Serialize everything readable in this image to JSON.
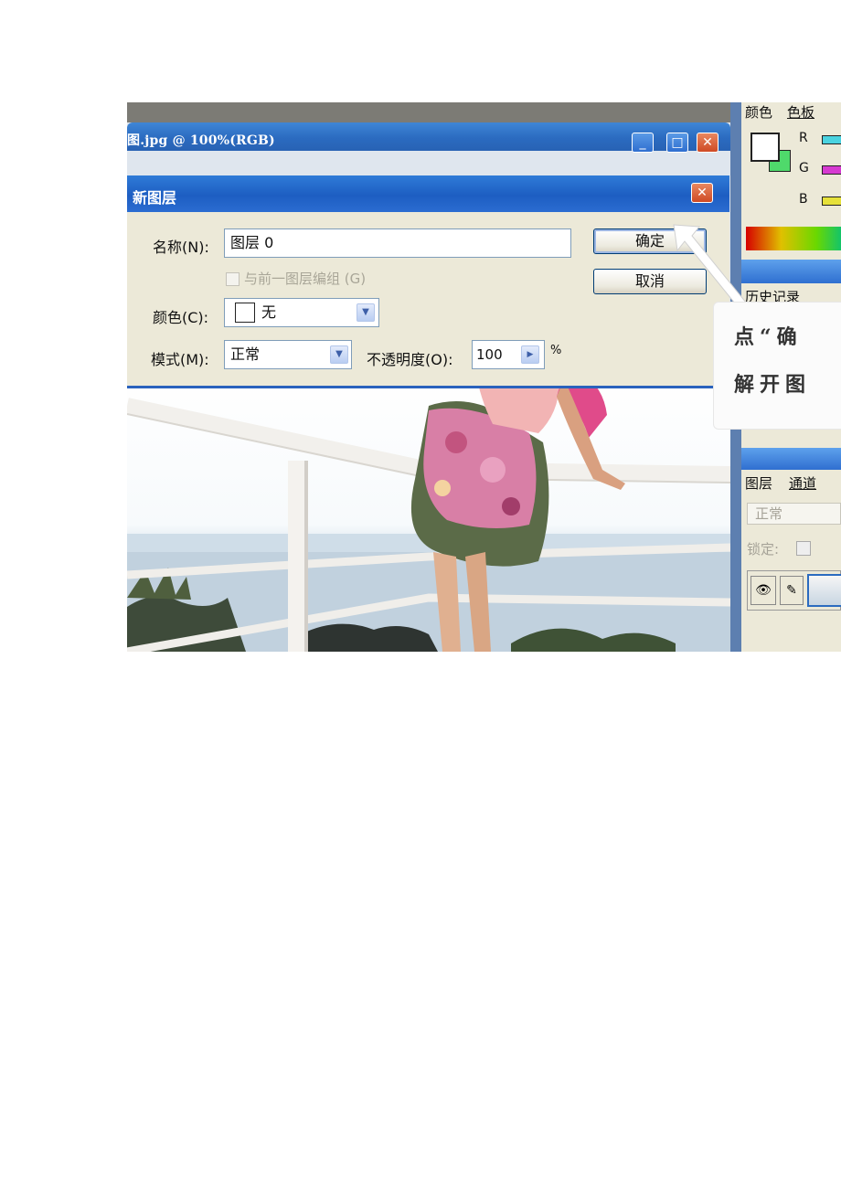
{
  "document": {
    "title": "图.jpg @ 100%(RGB)",
    "controls": {
      "minimize": "_",
      "maximize": "□",
      "close": "✕"
    }
  },
  "dialog": {
    "title": "新图层",
    "close": "✕",
    "name_label": "名称(N):",
    "name_value": "图层 0",
    "group_label": "与前一图层编组 (G)",
    "color_label": "颜色(C):",
    "color_value": "无",
    "mode_label": "模式(M):",
    "mode_value": "正常",
    "opacity_label": "不透明度(O):",
    "opacity_value": "100",
    "opacity_unit": "%",
    "ok_label": "确定",
    "cancel_label": "取消"
  },
  "color_panel": {
    "tab_color": "颜色",
    "tab_swatches": "色板",
    "channels": [
      "R",
      "G",
      "B"
    ]
  },
  "history_panel": {
    "tab_history": "历史记录"
  },
  "layers_panel": {
    "tab_layers": "图层",
    "tab_channels": "通道",
    "blend_mode": "正常",
    "lock_label": "锁定:"
  },
  "callout": {
    "line1": "点“确",
    "line2": "解开图"
  },
  "colors": {
    "titlebar_blue": "#2b6bc0",
    "dialog_bg": "#ece9d8",
    "close_red": "#d4532c"
  }
}
